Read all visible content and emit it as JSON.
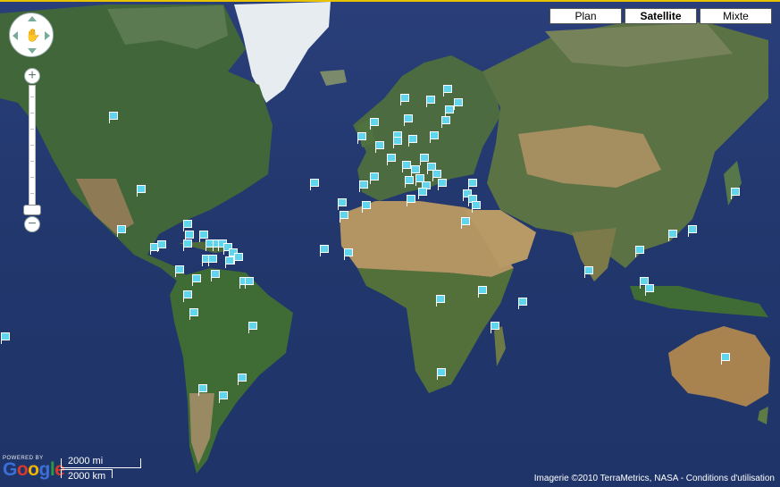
{
  "map_type_buttons": [
    {
      "label": "Plan",
      "active": false
    },
    {
      "label": "Satellite",
      "active": true
    },
    {
      "label": "Mixte",
      "active": false
    }
  ],
  "controls": {
    "zoom_in_symbol": "+",
    "zoom_out_symbol": "−",
    "pan_icon": "hand-pan-icon"
  },
  "branding": {
    "powered": "POWERED BY",
    "letters": [
      {
        "ch": "G",
        "color": "#3b6fd8"
      },
      {
        "ch": "o",
        "color": "#d63a2c"
      },
      {
        "ch": "o",
        "color": "#f0b400"
      },
      {
        "ch": "g",
        "color": "#3b6fd8"
      },
      {
        "ch": "l",
        "color": "#2c9a3a"
      },
      {
        "ch": "e",
        "color": "#d63a2c"
      }
    ]
  },
  "scale": {
    "miles": "2000 mi",
    "km": "2000 km"
  },
  "attribution": "Imagerie ©2010 TerraMetrics, NASA - Conditions d'utilisation",
  "colors": {
    "ocean": "#22386e",
    "land_green": "#3f6b3a",
    "desert": "#b39463",
    "ice": "#e6ecef",
    "marker": "#5fd6ee",
    "top_border": "#e8c400"
  },
  "marker_icon": "flag-marker-icon"
}
